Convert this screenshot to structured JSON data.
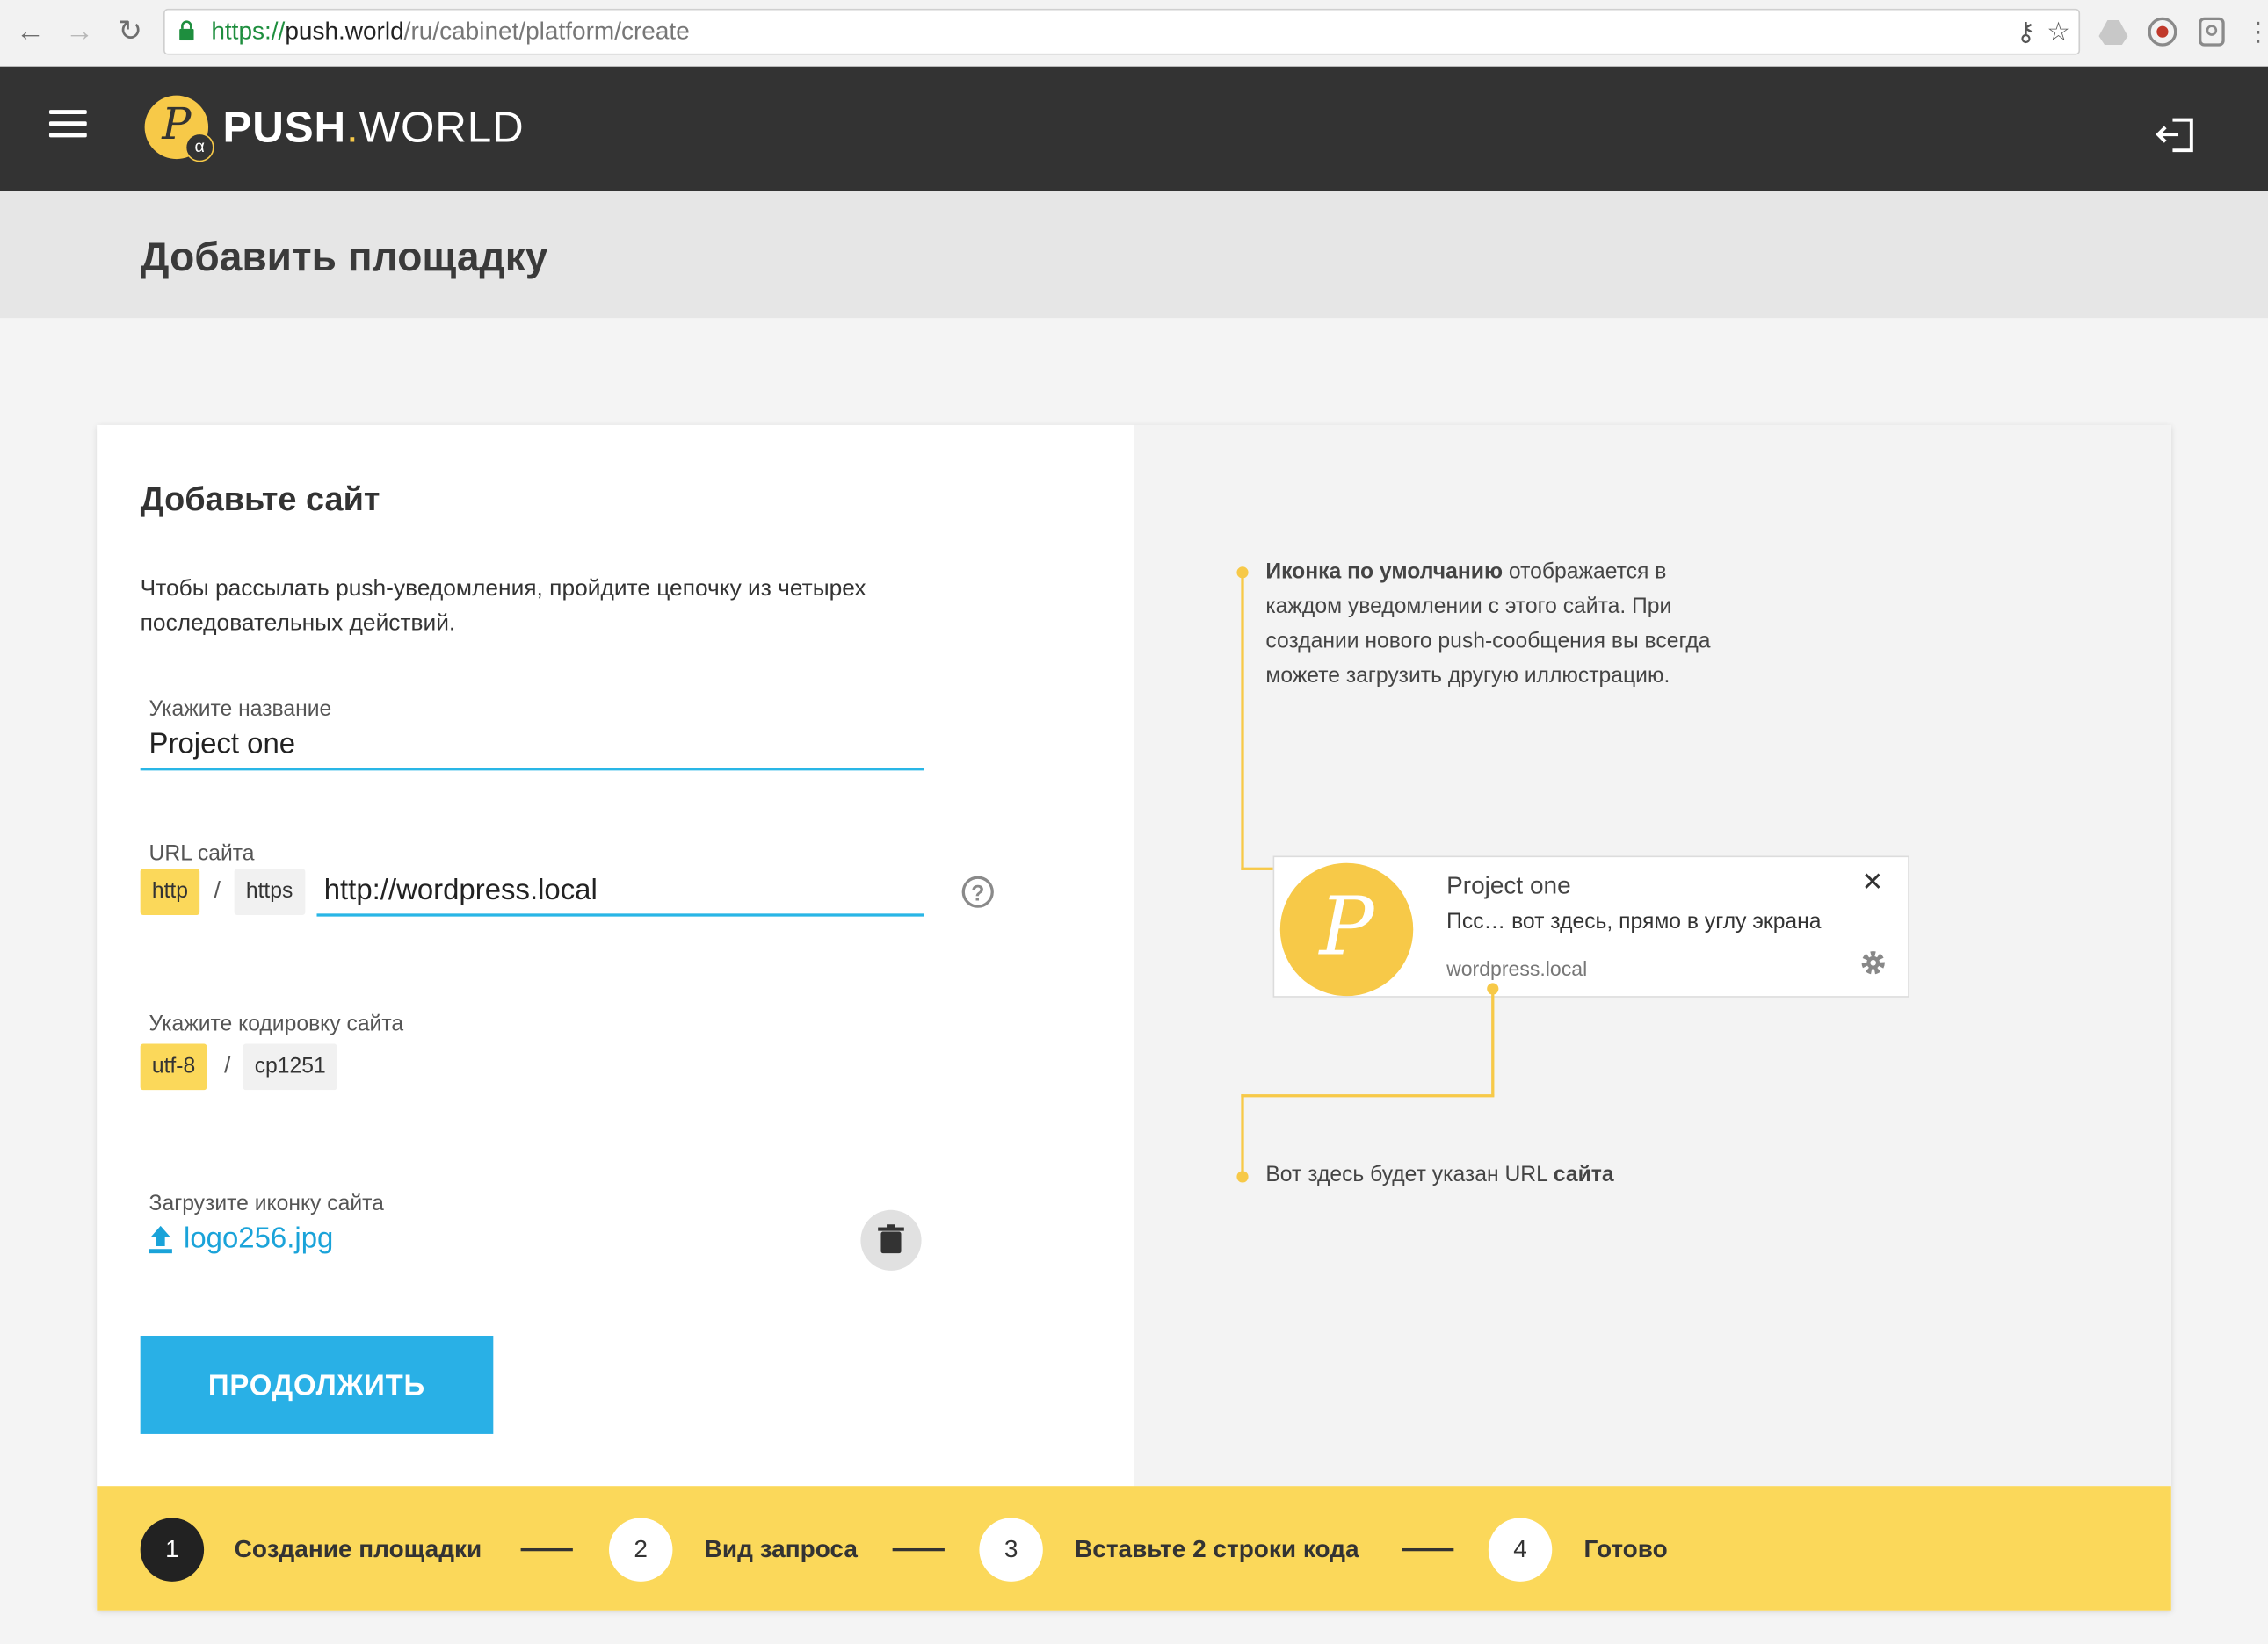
{
  "browser": {
    "url_scheme": "https://",
    "url_host": "push.world",
    "url_path": "/ru/cabinet/platform/create",
    "icons": [
      "back-arrow-icon",
      "forward-arrow-icon",
      "reload-icon",
      "lock-icon",
      "key-icon",
      "star-icon"
    ]
  },
  "app": {
    "brand_push": "PUSH",
    "brand_dot": ".",
    "brand_world": "WORLD",
    "logo_letter": "P",
    "logo_badge": "α"
  },
  "page": {
    "title": "Добавить площадку"
  },
  "form": {
    "title": "Добавьте сайт",
    "intro": "Чтобы рассылать push-уведомления, пройдите цепочку из четырех последовательных действий.",
    "name_label": "Укажите название",
    "name_value": "Project one",
    "url_label": "URL сайта",
    "protocol_options": [
      "http",
      "https"
    ],
    "protocol_separator": "/",
    "url_value": "http://wordpress.local",
    "help_symbol": "?",
    "encoding_label": "Укажите кодировку сайта",
    "encoding_options": [
      "utf-8",
      "cp1251"
    ],
    "encoding_separator": "/",
    "icon_label": "Загрузите иконку сайта",
    "icon_file": "logo256.jpg",
    "continue_label": "ПРОДОЛЖИТЬ"
  },
  "preview": {
    "hint_icon_bold": "Иконка по умолчанию",
    "hint_icon_rest": " отображается в каждом уведомлении с этого сайта. При создании нового push-сообщения вы всегда можете загрузить другую иллюстрацию.",
    "notif_title": "Project one",
    "notif_body": "Псс… вот здесь, прямо в углу экрана",
    "notif_site": "wordpress.local",
    "notif_close": "✕",
    "notif_logo_letter": "P",
    "hint_url_pre": "Вот здесь будет указан URL ",
    "hint_url_bold": "сайта"
  },
  "steps": [
    {
      "num": "1",
      "label": "Создание площадки",
      "active": true
    },
    {
      "num": "2",
      "label": "Вид запроса",
      "active": false
    },
    {
      "num": "3",
      "label": "Вставьте 2 строки кода",
      "active": false
    },
    {
      "num": "4",
      "label": "Готово",
      "active": false
    }
  ],
  "colors": {
    "accent_yellow": "#fbd85a",
    "accent_blue": "#29b0e6",
    "header_dark": "#333333"
  }
}
